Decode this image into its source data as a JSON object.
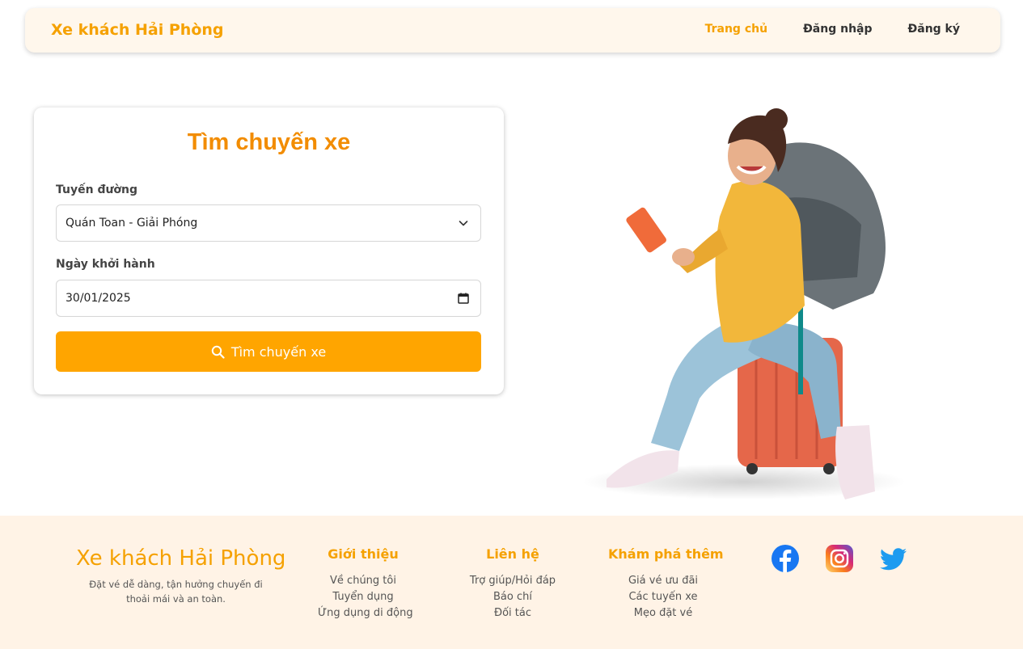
{
  "header": {
    "brand": "Xe khách Hải Phòng",
    "nav": [
      {
        "label": "Trang chủ",
        "active": true
      },
      {
        "label": "Đăng nhập",
        "active": false
      },
      {
        "label": "Đăng ký",
        "active": false
      }
    ]
  },
  "search": {
    "title": "Tìm chuyến xe",
    "route_label": "Tuyến đường",
    "route_value": "Quán Toan - Giải Phóng",
    "date_label": "Ngày khởi hành",
    "date_value": "30/01/2025",
    "button_label": "Tìm chuyến xe"
  },
  "footer": {
    "brand": "Xe khách Hải Phòng",
    "tagline": "Đặt vé dễ dàng, tận hưởng chuyến đi thoải mái và an toàn.",
    "columns": [
      {
        "title": "Giới thiệu",
        "links": [
          "Về chúng tôi",
          "Tuyển dụng",
          "Ứng dụng di động"
        ]
      },
      {
        "title": "Liên hệ",
        "links": [
          "Trợ giúp/Hỏi đáp",
          "Báo chí",
          "Đối tác"
        ]
      },
      {
        "title": "Khám phá thêm",
        "links": [
          "Giá vé ưu đãi",
          "Các tuyến xe",
          "Mẹo đặt vé"
        ]
      }
    ],
    "social": [
      "facebook-icon",
      "instagram-icon",
      "twitter-icon"
    ]
  },
  "colors": {
    "accent": "#f5a100",
    "button": "#ffa500",
    "footer_bg": "#fff3e6",
    "navbar_bg": "#fff7ec"
  }
}
